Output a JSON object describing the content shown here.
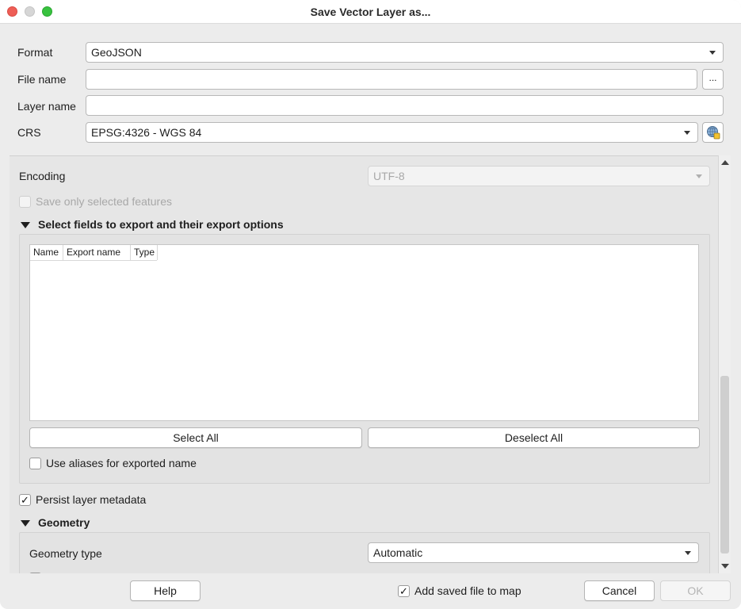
{
  "window": {
    "title": "Save Vector Layer as..."
  },
  "form": {
    "format_label": "Format",
    "format_value": "GeoJSON",
    "file_name_label": "File name",
    "file_name_value": "",
    "browse_label": "...",
    "layer_name_label": "Layer name",
    "layer_name_value": "",
    "crs_label": "CRS",
    "crs_value": "EPSG:4326 - WGS 84",
    "crs_selector_icon": "globe-crs-icon"
  },
  "options": {
    "encoding_label": "Encoding",
    "encoding_value": "UTF-8",
    "save_selected_label": "Save only selected features",
    "save_selected_checked": false,
    "fields_section_title": "Select fields to export and their export options",
    "table_headers": [
      "Name",
      "Export name",
      "Type"
    ],
    "table_rows": [],
    "select_all_label": "Select All",
    "deselect_all_label": "Deselect All",
    "use_aliases_label": "Use aliases for exported name",
    "use_aliases_checked": false,
    "persist_metadata_label": "Persist layer metadata",
    "persist_metadata_checked": true,
    "geometry_section_title": "Geometry",
    "geometry_type_label": "Geometry type",
    "geometry_type_value": "Automatic"
  },
  "footer": {
    "help_label": "Help",
    "add_to_map_label": "Add saved file to map",
    "add_to_map_checked": true,
    "cancel_label": "Cancel",
    "ok_label": "OK"
  },
  "colors": {
    "close": "#ee5e56",
    "minimize": "#d6d6d6",
    "maximize": "#38c23f",
    "window_bg": "#ececec"
  }
}
